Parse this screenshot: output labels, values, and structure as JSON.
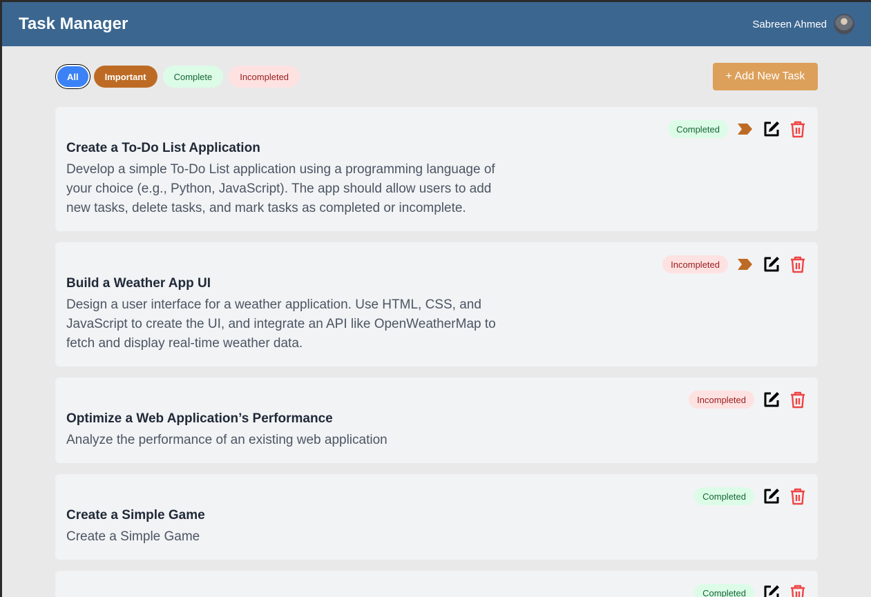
{
  "header": {
    "title": "Task Manager",
    "user_name": "Sabreen Ahmed"
  },
  "filters": {
    "all": "All",
    "important": "Important",
    "complete": "Complete",
    "incompleted": "Incompleted"
  },
  "add_button": "+ Add New Task",
  "tasks": [
    {
      "title": "Create a To-Do List Application",
      "description": "Develop a simple To-Do List application using a programming language of your choice (e.g., Python, JavaScript). The app should allow users to add new tasks, delete tasks, and mark tasks as completed or incomplete.",
      "status": "Completed",
      "important": true
    },
    {
      "title": "Build a Weather App UI",
      "description": "Design a user interface for a weather application. Use HTML, CSS, and JavaScript to create the UI, and integrate an API like OpenWeatherMap to fetch and display real-time weather data.",
      "status": "Incompleted",
      "important": true
    },
    {
      "title": "Optimize a Web Application’s Performance",
      "description": "Analyze the performance of an existing web application",
      "status": "Incompleted",
      "important": false
    },
    {
      "title": "Create a Simple Game",
      "description": "Create a Simple Game",
      "status": "Completed",
      "important": false
    },
    {
      "title": "",
      "description": "",
      "status": "Completed",
      "important": false
    }
  ]
}
